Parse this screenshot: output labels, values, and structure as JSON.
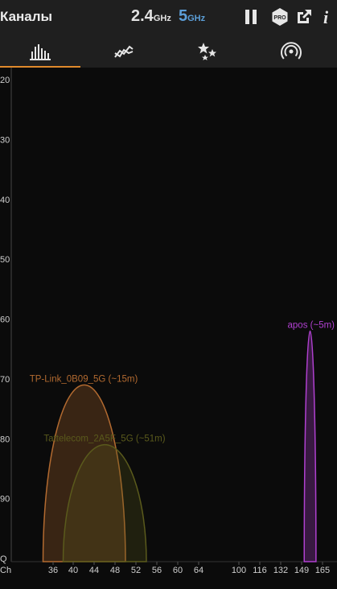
{
  "header": {
    "title": "Каналы",
    "band_24": {
      "value": "2.4",
      "unit": "GHz"
    },
    "band_5": {
      "value": "5",
      "unit": "GHz"
    },
    "icons": [
      "pause-icon",
      "pro-badge-icon",
      "share-icon",
      "info-icon"
    ],
    "pro_label": "PRO",
    "info_label": "i"
  },
  "tabs": [
    {
      "name": "channel-graph",
      "icon": "bar-chart-icon",
      "active": true
    },
    {
      "name": "time-graph",
      "icon": "line-graph-icon",
      "active": false
    },
    {
      "name": "channel-rating",
      "icon": "stars-icon",
      "active": false
    },
    {
      "name": "access-points",
      "icon": "wifi-signal-icon",
      "active": false
    }
  ],
  "colors": {
    "accent": "#e08a2c",
    "blue": "#5c9fd8",
    "tplink": "#b26a30",
    "tattelecom": "#5a5a1c",
    "apos": "#b040d0"
  },
  "chart_data": {
    "type": "area",
    "y_ticks": [
      "20",
      "30",
      "40",
      "50",
      "60",
      "70",
      "80",
      "90",
      "Q"
    ],
    "ylim": [
      -100,
      -20
    ],
    "x_axis_label": "Ch",
    "x_ticks": [
      36,
      40,
      44,
      48,
      52,
      56,
      60,
      64,
      100,
      116,
      132,
      149,
      165
    ],
    "networks": [
      {
        "name": "TP-Link_0B09_5G (~15m)",
        "center_channel": 42,
        "channel_span": [
          34,
          50
        ],
        "signal_dbm": -71,
        "color": "#b26a30"
      },
      {
        "name": "Tattelecom_2A5F_5G (~51m)",
        "center_channel": 46,
        "channel_span": [
          38,
          54
        ],
        "signal_dbm": -81,
        "color": "#5a5a1c"
      },
      {
        "name": "apos (~5m)",
        "center_channel": 155,
        "channel_span": [
          151,
          160
        ],
        "signal_dbm": -62,
        "color": "#b040d0"
      }
    ]
  }
}
